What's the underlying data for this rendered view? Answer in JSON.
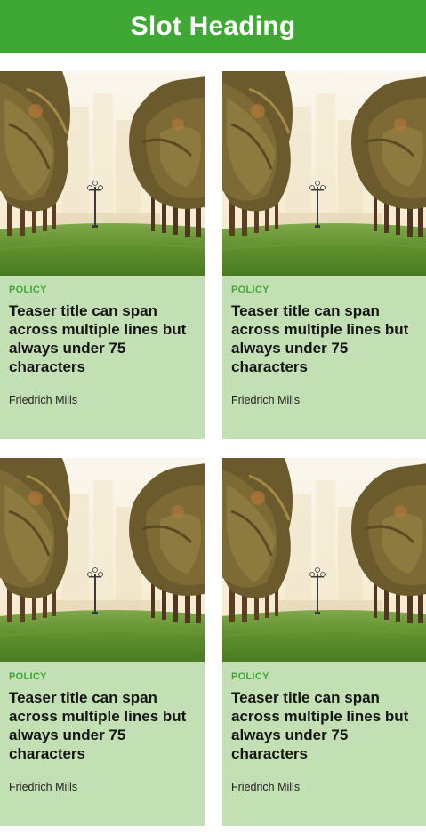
{
  "header": {
    "title": "Slot Heading"
  },
  "colors": {
    "brand_green": "#3fa835",
    "card_background": "#c3e0b4"
  },
  "cards": [
    {
      "category": "POLICY",
      "title": "Teaser title can span across multiple lines but always under 75 characters",
      "author": "Friedrich Mills",
      "image": "palm-park-photo"
    },
    {
      "category": "POLICY",
      "title": "Teaser title can span across multiple lines but always under 75 characters",
      "author": "Friedrich Mills",
      "image": "palm-park-photo"
    },
    {
      "category": "POLICY",
      "title": "Teaser title can span across multiple lines but always under 75 characters",
      "author": "Friedrich Mills",
      "image": "palm-park-photo"
    },
    {
      "category": "POLICY",
      "title": "Teaser title can span across multiple lines but always under 75 characters",
      "author": "Friedrich Mills",
      "image": "palm-park-photo"
    }
  ]
}
